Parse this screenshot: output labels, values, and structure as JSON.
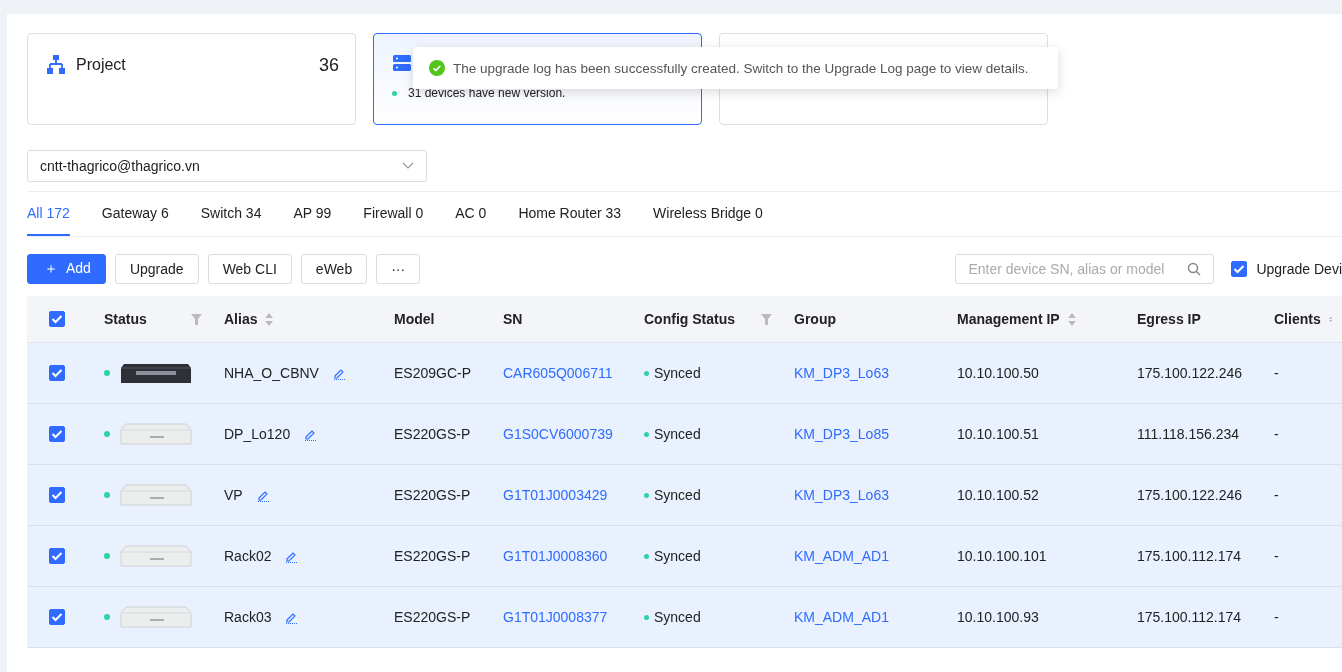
{
  "cards": [
    {
      "kind": "project",
      "label": "Project",
      "count": "36",
      "selected": false
    },
    {
      "kind": "device",
      "note": "31 devices have new version.",
      "selected": true
    },
    {
      "kind": "empty",
      "selected": false
    }
  ],
  "toast": {
    "message": "The upgrade log has been successfully created. Switch to the Upgrade Log page to view details."
  },
  "account_select": {
    "value": "cntt-thagrico@thagrico.vn"
  },
  "tabs": [
    {
      "label": "All 172",
      "selected": true
    },
    {
      "label": "Gateway 6",
      "selected": false
    },
    {
      "label": "Switch 34",
      "selected": false
    },
    {
      "label": "AP 99",
      "selected": false
    },
    {
      "label": "Firewall 0",
      "selected": false
    },
    {
      "label": "AC 0",
      "selected": false
    },
    {
      "label": "Home Router 33",
      "selected": false
    },
    {
      "label": "Wireless Bridge 0",
      "selected": false
    }
  ],
  "toolbar": {
    "buttons": [
      {
        "kind": "primary",
        "label": "Add",
        "icon": "＋"
      },
      {
        "kind": "plain",
        "label": "Upgrade"
      },
      {
        "kind": "plain",
        "label": "Web CLI"
      },
      {
        "kind": "plain",
        "label": "eWeb"
      },
      {
        "kind": "plain",
        "label": "···"
      }
    ],
    "search": {
      "placeholder": "Enter device SN, alias or model"
    },
    "upgrade_filter": {
      "label": "Upgrade Devi",
      "checked": true
    }
  },
  "table": {
    "all_checked": true,
    "columns": [
      {
        "label": "Status",
        "filterable": true,
        "sortable": false
      },
      {
        "label": "Alias",
        "filterable": false,
        "sortable": true
      },
      {
        "label": "Model",
        "filterable": false,
        "sortable": false
      },
      {
        "label": "SN",
        "filterable": false,
        "sortable": false
      },
      {
        "label": "Config Status",
        "filterable": true,
        "sortable": false
      },
      {
        "label": "Group",
        "filterable": false,
        "sortable": false
      },
      {
        "label": "Management IP",
        "filterable": false,
        "sortable": true
      },
      {
        "label": "Egress IP",
        "filterable": false,
        "sortable": false
      },
      {
        "label": "Clients",
        "filterable": false,
        "sortable": true
      }
    ],
    "rows": [
      {
        "checked": true,
        "online": true,
        "kind": "dark",
        "alias": "NHA_O_CBNV",
        "model": "ES209GC-P",
        "sn": "CAR605Q006711",
        "config_status": "Synced",
        "group": "KM_DP3_Lo63",
        "management_ip": "10.10.100.50",
        "egress_ip": "175.100.122.246",
        "clients": "-"
      },
      {
        "checked": true,
        "online": true,
        "kind": "light",
        "alias": "DP_Lo120",
        "model": "ES220GS-P",
        "sn": "G1S0CV6000739",
        "config_status": "Synced",
        "group": "KM_DP3_Lo85",
        "management_ip": "10.10.100.51",
        "egress_ip": "111.118.156.234",
        "clients": "-"
      },
      {
        "checked": true,
        "online": true,
        "kind": "light",
        "alias": "VP",
        "model": "ES220GS-P",
        "sn": "G1T01J0003429",
        "config_status": "Synced",
        "group": "KM_DP3_Lo63",
        "management_ip": "10.10.100.52",
        "egress_ip": "175.100.122.246",
        "clients": "-"
      },
      {
        "checked": true,
        "online": true,
        "kind": "light",
        "alias": "Rack02",
        "model": "ES220GS-P",
        "sn": "G1T01J0008360",
        "config_status": "Synced",
        "group": "KM_ADM_AD1",
        "management_ip": "10.10.100.101",
        "egress_ip": "175.100.112.174",
        "clients": "-"
      },
      {
        "checked": true,
        "online": true,
        "kind": "light",
        "alias": "Rack03",
        "model": "ES220GS-P",
        "sn": "G1T01J0008377",
        "config_status": "Synced",
        "group": "KM_ADM_AD1",
        "management_ip": "10.10.100.93",
        "egress_ip": "175.100.112.174",
        "clients": "-"
      }
    ]
  }
}
